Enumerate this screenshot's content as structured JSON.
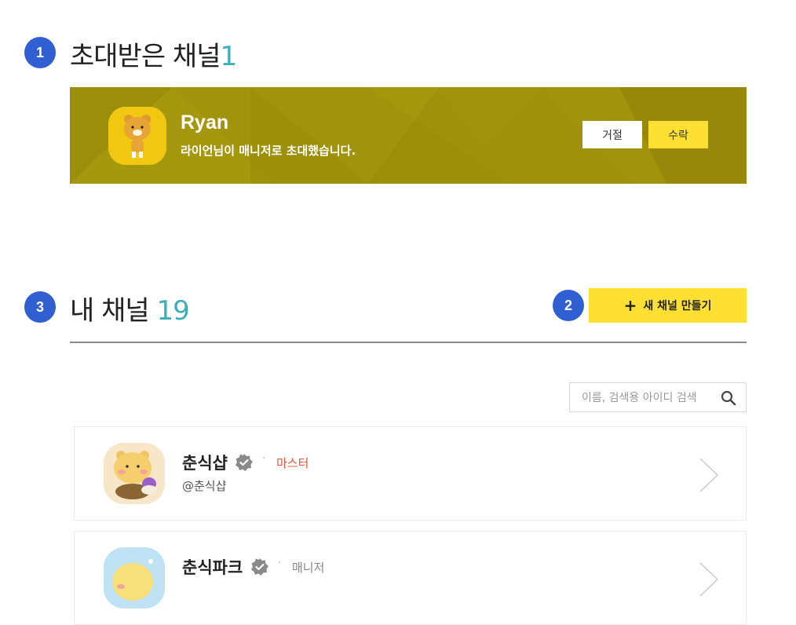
{
  "sections": {
    "invited": {
      "badge": "1",
      "title": "초대받은 채널",
      "count": "1"
    },
    "mine": {
      "badge": "3",
      "title": "내 채널",
      "count": "19"
    }
  },
  "invite": {
    "name": "Ryan",
    "message": "라이언님이 매니저로 초대했습니다.",
    "reject_label": "거절",
    "accept_label": "수락",
    "banner_color": "#a1930b"
  },
  "new_channel": {
    "badge": "2",
    "label": "새 채널 만들기",
    "icon": "plus-icon"
  },
  "search": {
    "placeholder": "이름, 검색용 아이디 검색",
    "icon": "search-icon"
  },
  "channels": [
    {
      "name": "춘식샵",
      "role": "마스터",
      "role_color": "#e8553a",
      "handle": "@춘식샵"
    },
    {
      "name": "춘식파크",
      "role": "매니저",
      "role_color": "#888888"
    }
  ],
  "colors": {
    "accent_yellow": "#fee032",
    "badge_blue": "#2f5fd0",
    "count_teal": "#3bb0b9"
  }
}
